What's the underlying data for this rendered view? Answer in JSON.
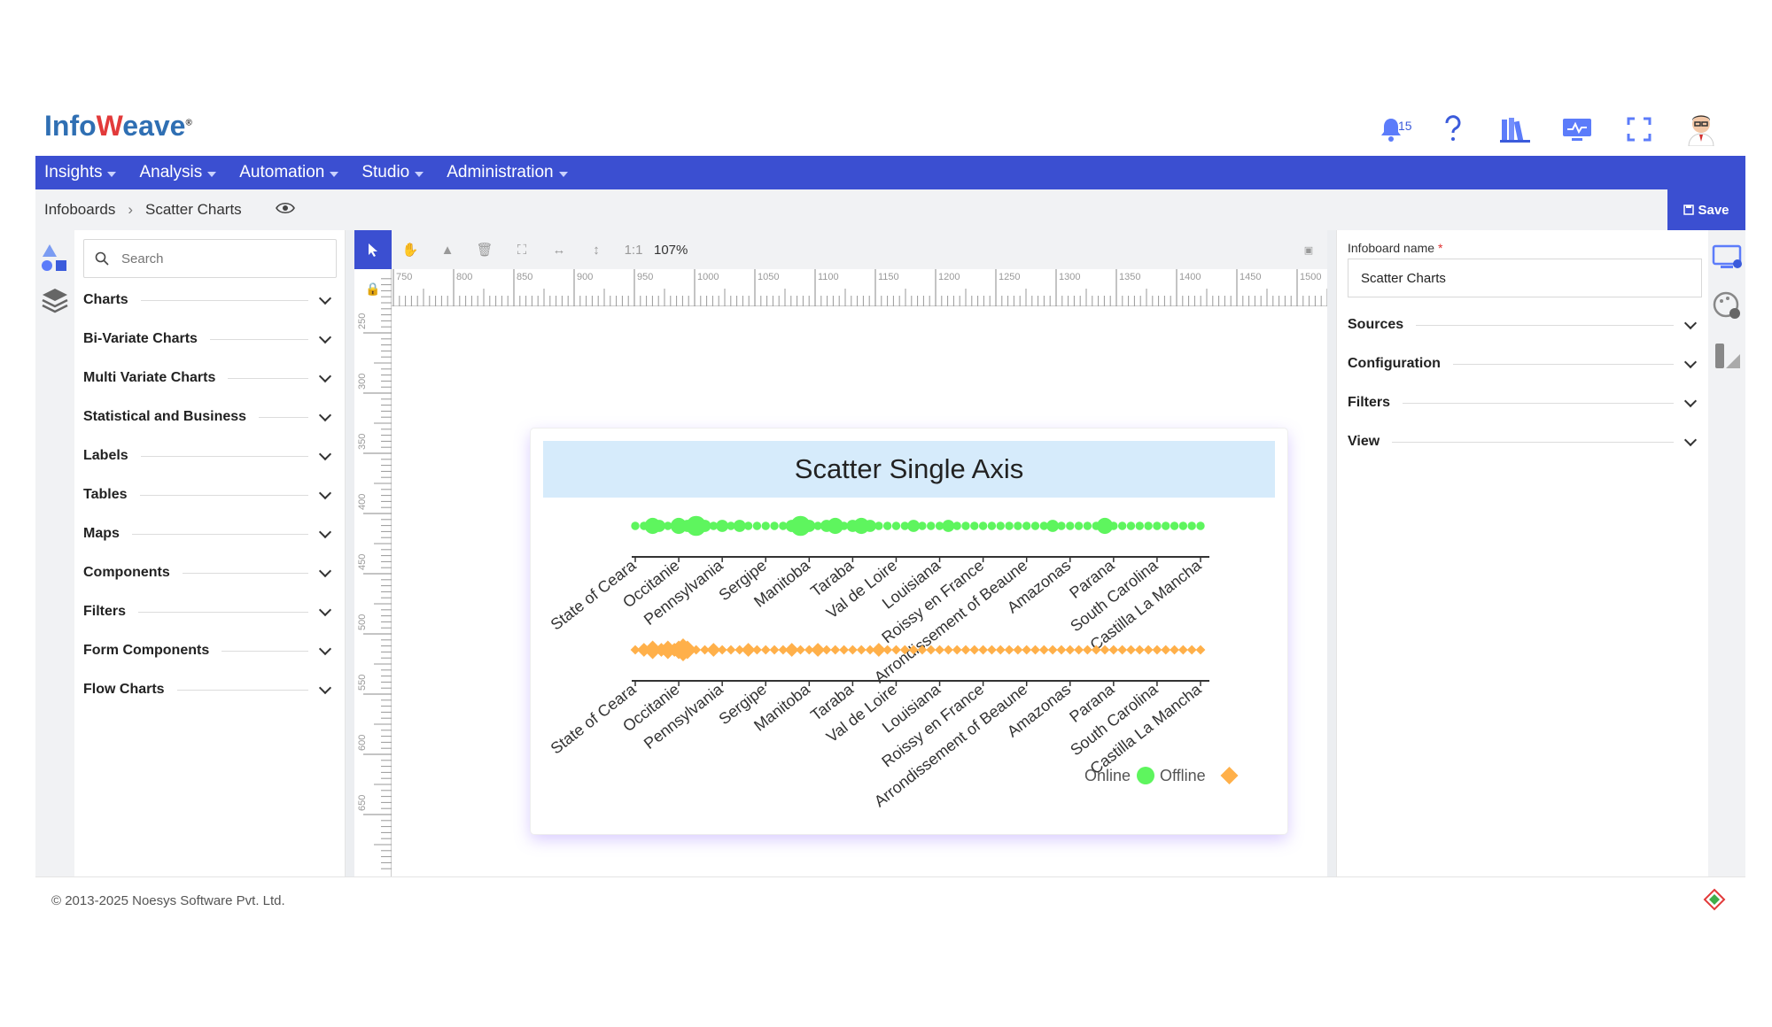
{
  "brand": {
    "logo_prefix": "Info",
    "logo_w": "W",
    "logo_suffix": "eave",
    "logo_mark": "®"
  },
  "header": {
    "notification_count": "15"
  },
  "menu": [
    {
      "label": "Insights"
    },
    {
      "label": "Analysis"
    },
    {
      "label": "Automation"
    },
    {
      "label": "Studio"
    },
    {
      "label": "Administration"
    }
  ],
  "breadcrumb": {
    "root": "Infoboards",
    "current": "Scatter Charts",
    "save_label": "Save"
  },
  "palette": {
    "search_placeholder": "Search",
    "categories": [
      {
        "label": "Charts"
      },
      {
        "label": "Bi-Variate Charts"
      },
      {
        "label": "Multi Variate Charts"
      },
      {
        "label": "Statistical and Business"
      },
      {
        "label": "Labels"
      },
      {
        "label": "Tables"
      },
      {
        "label": "Maps"
      },
      {
        "label": "Components"
      },
      {
        "label": "Filters"
      },
      {
        "label": "Form Components"
      },
      {
        "label": "Flow Charts"
      }
    ]
  },
  "toolbar": {
    "ratio_label": "1:1",
    "zoom": "107%"
  },
  "rulers": {
    "h_labels": [
      "750",
      "800",
      "850",
      "900",
      "950",
      "1000",
      "1050",
      "1100",
      "1150",
      "1200",
      "1250",
      "1300",
      "1350",
      "1400",
      "1450",
      "1500"
    ],
    "v_labels": [
      "250",
      "300",
      "350",
      "400",
      "450",
      "500",
      "550",
      "600",
      "650"
    ]
  },
  "properties": {
    "infoboard_name_label": "Infoboard name",
    "required_mark": "*",
    "infoboard_name_value": "Scatter Charts",
    "sections": [
      {
        "label": "Sources"
      },
      {
        "label": "Configuration"
      },
      {
        "label": "Filters"
      },
      {
        "label": "View"
      }
    ]
  },
  "footer": {
    "copyright": "© 2013-2025 Noesys Software Pvt. Ltd."
  },
  "colors": {
    "primary": "#3b4fd1",
    "online": "#5ef55e",
    "offline": "#ffb04a"
  },
  "chart_data": {
    "type": "scatter",
    "title": "Scatter Single Axis",
    "categories": [
      "State of Ceara",
      "Occitanie",
      "Pennsylvania",
      "Sergipe",
      "Manitoba",
      "Taraba",
      "Val de Loire",
      "Louisiana",
      "Roissy en France",
      "Arrondissement of Beaune",
      "Amazonas",
      "Parana",
      "South Carolina",
      "Castilla La Mancha"
    ],
    "series": [
      {
        "name": "Online",
        "marker": "circle",
        "color": "#5ef55e",
        "points": [
          [
            0.0,
            1
          ],
          [
            0.2,
            1
          ],
          [
            0.4,
            3
          ],
          [
            0.55,
            2
          ],
          [
            0.75,
            1
          ],
          [
            1.0,
            3
          ],
          [
            1.2,
            2
          ],
          [
            1.4,
            4
          ],
          [
            1.6,
            2
          ],
          [
            1.8,
            1
          ],
          [
            2.0,
            2
          ],
          [
            2.2,
            1
          ],
          [
            2.4,
            2
          ],
          [
            2.6,
            1
          ],
          [
            2.8,
            1
          ],
          [
            3.0,
            1
          ],
          [
            3.2,
            1
          ],
          [
            3.4,
            1
          ],
          [
            3.6,
            2
          ],
          [
            3.8,
            4
          ],
          [
            4.0,
            2
          ],
          [
            4.2,
            1
          ],
          [
            4.4,
            2
          ],
          [
            4.6,
            3
          ],
          [
            4.8,
            1
          ],
          [
            5.0,
            2
          ],
          [
            5.2,
            3
          ],
          [
            5.4,
            2
          ],
          [
            5.6,
            1
          ],
          [
            5.8,
            1
          ],
          [
            6.0,
            1
          ],
          [
            6.2,
            1
          ],
          [
            6.4,
            2
          ],
          [
            6.6,
            1
          ],
          [
            6.8,
            1
          ],
          [
            7.0,
            1
          ],
          [
            7.2,
            2
          ],
          [
            7.4,
            1
          ],
          [
            7.6,
            1
          ],
          [
            7.8,
            1
          ],
          [
            8.0,
            1
          ],
          [
            8.2,
            1
          ],
          [
            8.4,
            1
          ],
          [
            8.6,
            1
          ],
          [
            8.8,
            1
          ],
          [
            9.0,
            1
          ],
          [
            9.2,
            1
          ],
          [
            9.4,
            1
          ],
          [
            9.6,
            2
          ],
          [
            9.8,
            1
          ],
          [
            10.0,
            1
          ],
          [
            10.2,
            1
          ],
          [
            10.4,
            1
          ],
          [
            10.6,
            1
          ],
          [
            10.8,
            3
          ],
          [
            11.0,
            1
          ],
          [
            11.2,
            1
          ],
          [
            11.4,
            1
          ],
          [
            11.6,
            1
          ],
          [
            11.8,
            1
          ],
          [
            12.0,
            1
          ],
          [
            12.2,
            1
          ],
          [
            12.4,
            1
          ],
          [
            12.6,
            1
          ],
          [
            12.8,
            1
          ],
          [
            13.0,
            1
          ]
        ]
      },
      {
        "name": "Offline",
        "marker": "diamond",
        "color": "#ffb04a",
        "points": [
          [
            0.0,
            1
          ],
          [
            0.2,
            2
          ],
          [
            0.4,
            3
          ],
          [
            0.6,
            2
          ],
          [
            0.75,
            3
          ],
          [
            0.9,
            2
          ],
          [
            1.0,
            3
          ],
          [
            1.1,
            4
          ],
          [
            1.2,
            3
          ],
          [
            1.4,
            1
          ],
          [
            1.6,
            1
          ],
          [
            1.8,
            2
          ],
          [
            2.0,
            1
          ],
          [
            2.2,
            1
          ],
          [
            2.4,
            1
          ],
          [
            2.6,
            2
          ],
          [
            2.8,
            1
          ],
          [
            3.0,
            1
          ],
          [
            3.2,
            1
          ],
          [
            3.4,
            1
          ],
          [
            3.6,
            2
          ],
          [
            3.8,
            1
          ],
          [
            4.0,
            1
          ],
          [
            4.2,
            2
          ],
          [
            4.4,
            1
          ],
          [
            4.6,
            1
          ],
          [
            4.8,
            1
          ],
          [
            5.0,
            1
          ],
          [
            5.2,
            1
          ],
          [
            5.4,
            1
          ],
          [
            5.6,
            2
          ],
          [
            5.8,
            1
          ],
          [
            6.0,
            1
          ],
          [
            6.2,
            1
          ],
          [
            6.4,
            1
          ],
          [
            6.6,
            1
          ],
          [
            6.8,
            1
          ],
          [
            7.0,
            1
          ],
          [
            7.2,
            1
          ],
          [
            7.4,
            1
          ],
          [
            7.6,
            1
          ],
          [
            7.8,
            1
          ],
          [
            8.0,
            1
          ],
          [
            8.2,
            1
          ],
          [
            8.4,
            1
          ],
          [
            8.6,
            1
          ],
          [
            8.8,
            1
          ],
          [
            9.0,
            1
          ],
          [
            9.2,
            1
          ],
          [
            9.4,
            1
          ],
          [
            9.6,
            1
          ],
          [
            9.8,
            1
          ],
          [
            10.0,
            1
          ],
          [
            10.2,
            1
          ],
          [
            10.4,
            1
          ],
          [
            10.6,
            1
          ],
          [
            10.8,
            1
          ],
          [
            11.0,
            1
          ],
          [
            11.2,
            1
          ],
          [
            11.4,
            1
          ],
          [
            11.6,
            1
          ],
          [
            11.8,
            1
          ],
          [
            12.0,
            1
          ],
          [
            12.2,
            1
          ],
          [
            12.4,
            1
          ],
          [
            12.6,
            1
          ],
          [
            12.8,
            1
          ],
          [
            13.0,
            1
          ]
        ]
      }
    ],
    "legend": "bottom-right",
    "grid": false
  }
}
